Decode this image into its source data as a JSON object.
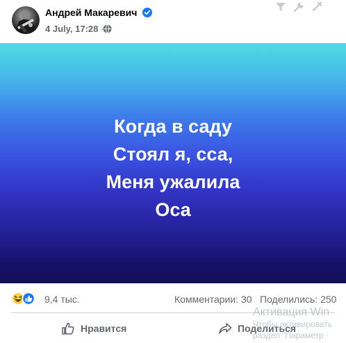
{
  "post": {
    "author": "Андрей Макаревич",
    "verified": true,
    "time": "4 July, 17:28",
    "separator": "·",
    "privacy_icon": "globe-icon",
    "avatar_icon": "guitarist-photo"
  },
  "toolbar_icons": [
    "filter-icon",
    "wrench-icon",
    "settings-icon"
  ],
  "image": {
    "lines": [
      "Когда в саду",
      "Стоял я, сса,",
      "Меня ужалила",
      "Оса"
    ],
    "gradient_top": "#4fdce2",
    "gradient_bottom": "#120f58"
  },
  "stats": {
    "reactions_count": "9,4 тыс.",
    "reaction_icons": [
      "haha-icon",
      "like-icon"
    ],
    "comments": "Комментарии: 30",
    "shares": "Поделились: 250"
  },
  "actions": {
    "like_label": "Нравится",
    "share_label": "Поделиться"
  },
  "watermark": {
    "title": "Активация Win",
    "line1": "Чтобы активировать",
    "line2": "раздел \"Параметр"
  },
  "colors": {
    "secondary_text": "#65676b",
    "verified_blue": "#1877f2",
    "like_blue": "#1877f2",
    "haha_yellow": "#f7d24b"
  }
}
